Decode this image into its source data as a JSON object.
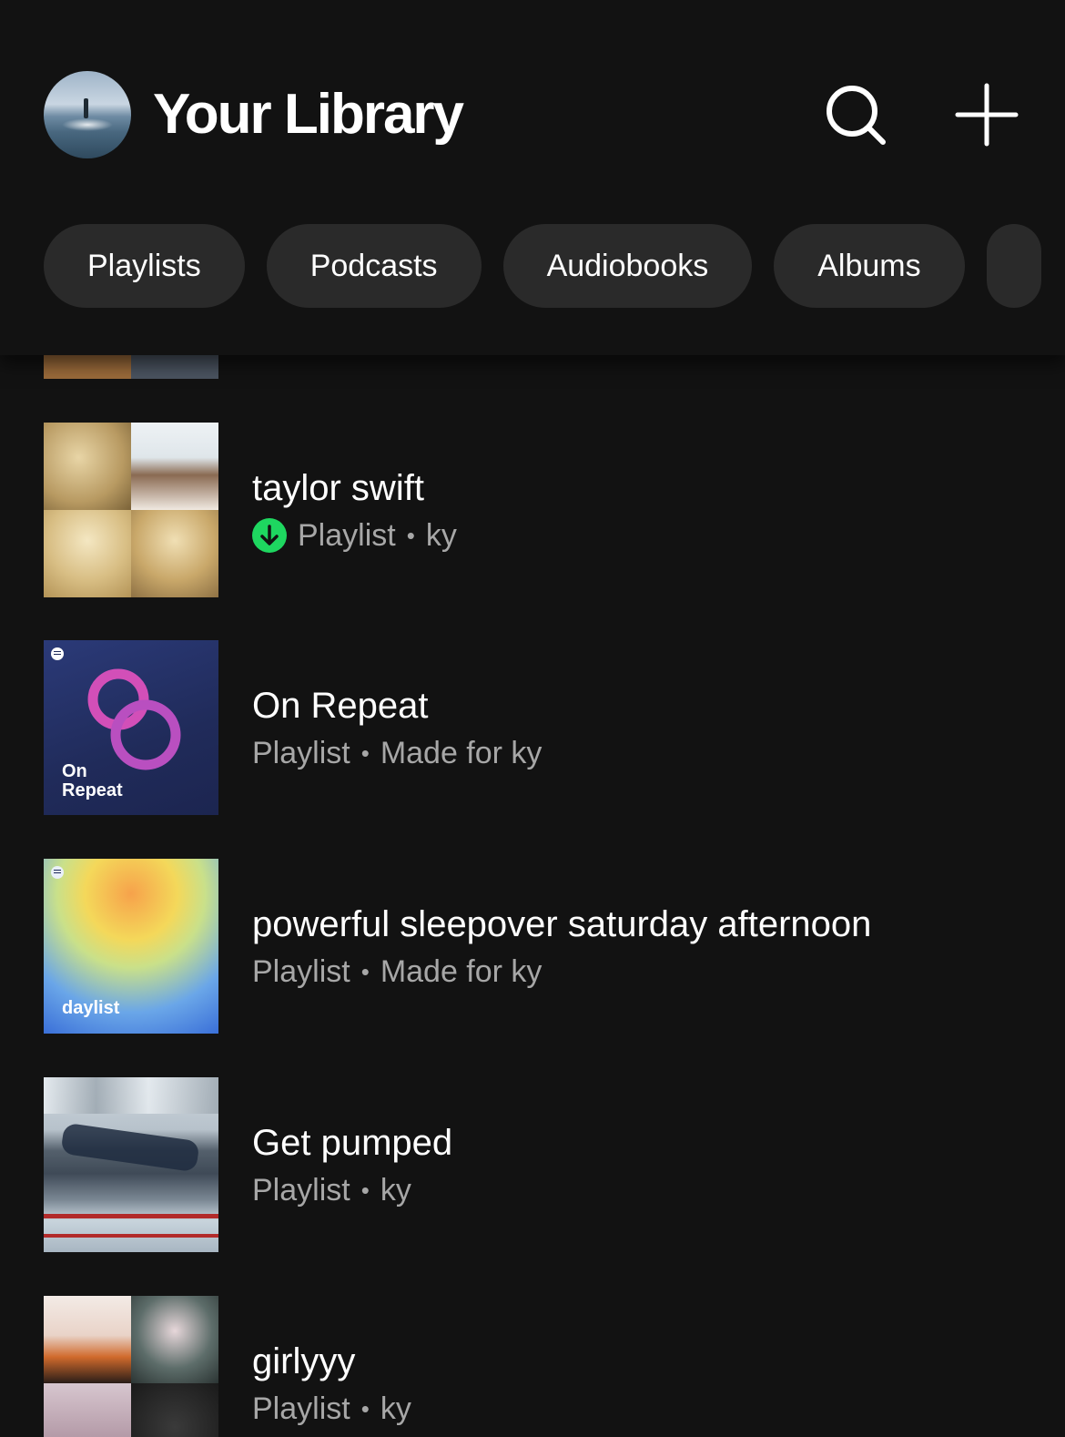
{
  "header": {
    "title": "Your Library"
  },
  "filters": [
    {
      "label": "Playlists"
    },
    {
      "label": "Podcasts"
    },
    {
      "label": "Audiobooks"
    },
    {
      "label": "Albums"
    }
  ],
  "items": [
    {
      "title": "taylor swift",
      "type": "Playlist",
      "owner": "ky",
      "downloaded": true
    },
    {
      "title": "On Repeat",
      "type": "Playlist",
      "owner": "Made for ky",
      "cover_text": [
        "On",
        "Repeat"
      ]
    },
    {
      "title": "powerful sleepover saturday afternoon",
      "type": "Playlist",
      "owner": "Made for ky",
      "cover_text": "daylist"
    },
    {
      "title": "Get pumped",
      "type": "Playlist",
      "owner": "ky"
    },
    {
      "title": "girlyyy",
      "type": "Playlist",
      "owner": "ky"
    }
  ],
  "colors": {
    "background": "#121212",
    "chip": "#2a2a2a",
    "subtext": "#a7a7a7",
    "download_green": "#1ed760"
  }
}
